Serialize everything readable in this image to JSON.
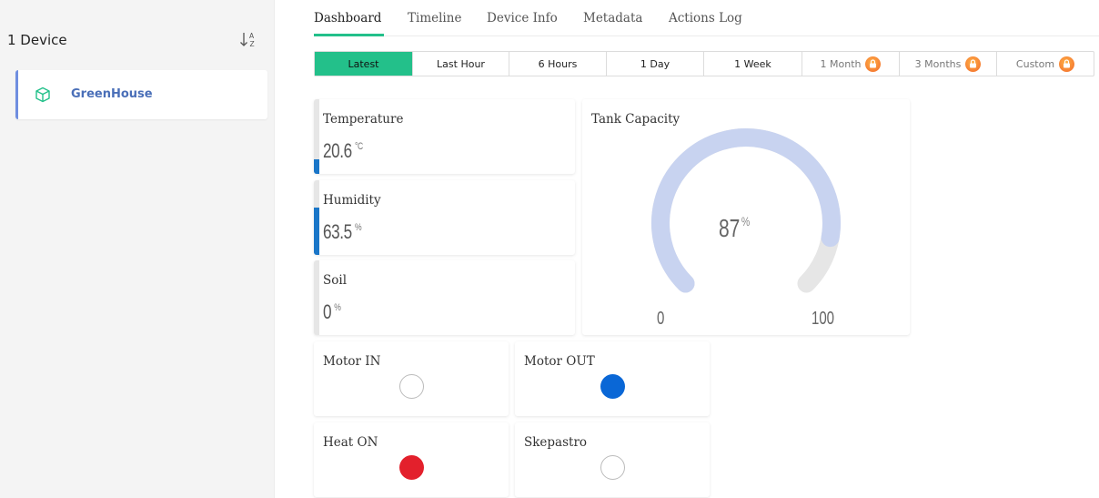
{
  "sidebar": {
    "device_count": "1 Device",
    "sort_icon": "sort-az-icon",
    "devices": [
      {
        "name": "GreenHouse",
        "icon": "cube-icon"
      }
    ]
  },
  "tabs": [
    {
      "label": "Dashboard",
      "active": true
    },
    {
      "label": "Timeline"
    },
    {
      "label": "Device Info"
    },
    {
      "label": "Metadata"
    },
    {
      "label": "Actions Log"
    }
  ],
  "ranges": [
    {
      "label": "Latest",
      "active": true
    },
    {
      "label": "Last Hour"
    },
    {
      "label": "6 Hours"
    },
    {
      "label": "1 Day"
    },
    {
      "label": "1 Week"
    },
    {
      "label": "1 Month",
      "locked": true
    },
    {
      "label": "3 Months",
      "locked": true
    },
    {
      "label": "Custom",
      "locked": true
    }
  ],
  "widgets": {
    "temperature": {
      "title": "Temperature",
      "value": "20.6",
      "unit": "°C",
      "level": 0.2
    },
    "humidity": {
      "title": "Humidity",
      "value": "63.5",
      "unit": "%",
      "level": 0.635
    },
    "soil": {
      "title": "Soil",
      "value": "0",
      "unit": "%",
      "level": 0
    },
    "tank": {
      "title": "Tank Capacity",
      "value": "87",
      "unit": "%",
      "min": "0",
      "max": "100",
      "level": 0.87
    },
    "motor_in": {
      "title": "Motor IN",
      "state": "off"
    },
    "motor_out": {
      "title": "Motor OUT",
      "state": "on",
      "color": "#0a67d6"
    },
    "heat_on": {
      "title": "Heat ON",
      "state": "on",
      "color": "#e3202c"
    },
    "skepastro": {
      "title": "Skepastro",
      "state": "off"
    }
  },
  "colors": {
    "accent": "#23c08a",
    "value_bar": "#1a76c8",
    "gauge_fill": "#c8d3f0",
    "gauge_track": "#e6e6e6",
    "lock": "#f2672a"
  }
}
